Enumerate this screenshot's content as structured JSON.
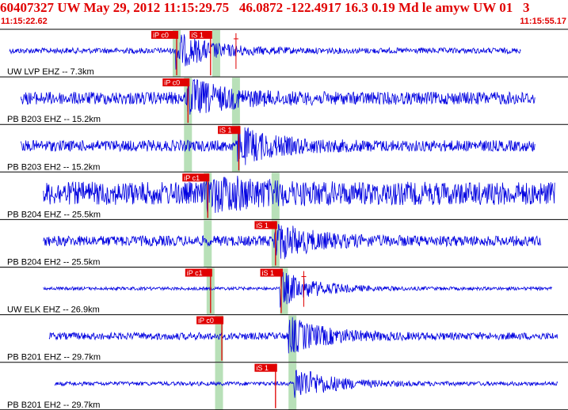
{
  "header": {
    "event_line": "60407327 UW May 29, 2012 11:15:29.75   46.0872 -122.4917 16.3 0.19 Md le amyw UW 01   3",
    "time_start": "11:15:22.62",
    "time_end": "11:15:55.17"
  },
  "colors": {
    "trace": "#0000e0",
    "pick": "#e00000",
    "residual_band": "#b8e0b8",
    "grid": "#000000",
    "title": "#e00000"
  },
  "channels": [
    {
      "label": "UW LVP EHZ -- 7.3km",
      "amp": 0.14,
      "trace_start": 0.0,
      "trace_end": 0.92,
      "arrival": 0.31,
      "picks": [
        {
          "label": "iP c0",
          "t": 0.31
        },
        {
          "label": "iS 1",
          "t": 0.37
        }
      ],
      "theory": [
        0.31,
        0.38
      ],
      "marks": [
        0.415
      ]
    },
    {
      "label": "PB B203 EHZ -- 15.2km",
      "amp": 0.32,
      "trace_start": 0.02,
      "trace_end": 0.945,
      "arrival": 0.33,
      "picks": [
        {
          "label": "iP c0",
          "t": 0.33
        }
      ],
      "theory": [
        0.33,
        0.415
      ],
      "marks": []
    },
    {
      "label": "PB B203 EH2 -- 15.2km",
      "amp": 0.28,
      "trace_start": 0.02,
      "trace_end": 0.945,
      "arrival": 0.42,
      "picks": [
        {
          "label": "iS 1",
          "t": 0.42
        }
      ],
      "theory": [
        0.33,
        0.415
      ],
      "marks": []
    },
    {
      "label": "PB B204 EHZ -- 25.5km",
      "amp": 0.58,
      "trace_start": 0.06,
      "trace_end": 0.98,
      "arrival": 0.365,
      "picks": [
        {
          "label": "iP c1",
          "t": 0.365
        }
      ],
      "theory": [
        0.365,
        0.485
      ],
      "marks": []
    },
    {
      "label": "PB B204 EH2 -- 25.5km",
      "amp": 0.26,
      "trace_start": 0.06,
      "trace_end": 0.955,
      "arrival": 0.485,
      "picks": [
        {
          "label": "iS 1",
          "t": 0.485
        }
      ],
      "theory": [
        0.365,
        0.485
      ],
      "marks": []
    },
    {
      "label": "UW ELK EHZ -- 26.9km",
      "amp": 0.08,
      "trace_start": 0.06,
      "trace_end": 0.975,
      "arrival": 0.495,
      "picks": [
        {
          "label": "iP c1",
          "t": 0.37
        },
        {
          "label": "iS 1",
          "t": 0.495
        }
      ],
      "theory": [
        0.37,
        0.5
      ],
      "marks": [
        0.535
      ]
    },
    {
      "label": "PB B201 EHZ -- 29.7km",
      "amp": 0.18,
      "trace_start": 0.07,
      "trace_end": 0.985,
      "arrival": 0.51,
      "picks": [
        {
          "label": "iP c0",
          "t": 0.39
        }
      ],
      "theory": [
        0.385,
        0.515
      ],
      "marks": []
    },
    {
      "label": "PB B201 EH2 -- 29.7km",
      "amp": 0.1,
      "trace_start": 0.08,
      "trace_end": 0.985,
      "arrival": 0.52,
      "picks": [
        {
          "label": "iS 1",
          "t": 0.485
        }
      ],
      "theory": [
        0.385,
        0.515
      ],
      "marks": []
    }
  ]
}
